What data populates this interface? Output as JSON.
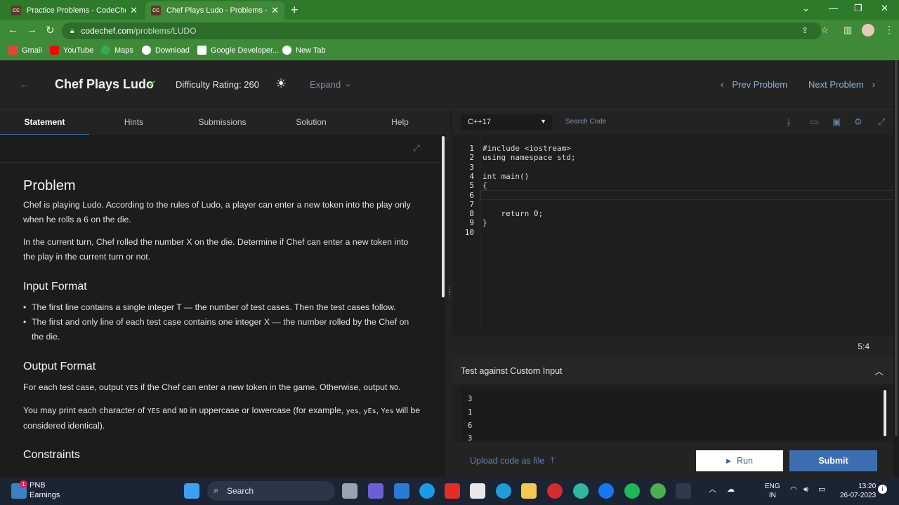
{
  "browser": {
    "tabs": [
      {
        "title": "Practice Problems - CodeChef",
        "active": false
      },
      {
        "title": "Chef Plays Ludo - Problems - Co",
        "active": true
      }
    ],
    "new_tab_glyph": "+",
    "favicon_text": "CC",
    "url_host": "codechef.com",
    "url_path": "/problems/LUDO",
    "bookmarks": [
      {
        "label": "Gmail",
        "color": "#ea4335"
      },
      {
        "label": "YouTube",
        "color": "#ff0000"
      },
      {
        "label": "Maps",
        "color": "#34a853"
      },
      {
        "label": "Download",
        "color": "#ffffff"
      },
      {
        "label": "Google Developer...",
        "color": "#ffffff"
      },
      {
        "label": "New Tab",
        "color": "#ffffff"
      }
    ]
  },
  "header": {
    "title": "Chef Plays Ludo",
    "difficulty": "Difficulty Rating: 260",
    "expand": "Expand",
    "prev": "Prev Problem",
    "next": "Next Problem"
  },
  "left_tabs": [
    "Statement",
    "Hints",
    "Submissions",
    "Solution",
    "Help"
  ],
  "statement": {
    "heading": "Problem",
    "p1": "Chef is playing Ludo. According to the rules of Ludo, a player can enter a new token into the play only when he rolls a 6 on the die.",
    "p2": "In the current turn, Chef rolled the number X on the die. Determine if Chef can enter a new token into the play in the current turn or not.",
    "input_heading": "Input Format",
    "input_items": [
      "The first line contains a single integer T — the number of test cases. Then the test cases follow.",
      "The first and only line of each test case contains one integer X — the number rolled by the Chef on the die."
    ],
    "output_heading": "Output Format",
    "output_p1_a": "For each test case, output ",
    "output_p1_yes": "YES",
    "output_p1_b": " if the Chef can enter a new token in the game. Otherwise, output ",
    "output_p1_no": "NO",
    "output_p1_c": ".",
    "output_p2_a": "You may print each character of ",
    "output_p2_yes": "YES",
    "output_p2_b": " and ",
    "output_p2_no": "NO",
    "output_p2_c": " in uppercase or lowercase (for example, ",
    "output_p2_e1": "yes",
    "output_p2_sep1": ", ",
    "output_p2_e2": "yEs",
    "output_p2_sep2": ", ",
    "output_p2_e3": "Yes",
    "output_p2_d": " will be considered identical).",
    "constraints_heading": "Constraints"
  },
  "editor": {
    "language": "C++17",
    "search_placeholder": "Search Code",
    "line_numbers": [
      "1",
      "2",
      "3",
      "4",
      "5",
      "6",
      "7",
      "8",
      "9",
      "10"
    ],
    "lines": [
      "#include <iostream>",
      "using namespace std;",
      "",
      "int main()",
      "{",
      "",
      "",
      "    return 0;",
      "}",
      ""
    ],
    "cursor": "5:4"
  },
  "custom_input": {
    "label": "Test against Custom Input",
    "values": [
      "3",
      "1",
      "6",
      "3"
    ]
  },
  "actions": {
    "upload": "Upload code as file",
    "run": "Run",
    "submit": "Submit"
  },
  "taskbar": {
    "news_title": "PNB",
    "news_sub": "Earnings",
    "news_badge": "1",
    "search": "Search",
    "lang_top": "ENG",
    "lang_bottom": "IN",
    "time": "13:20",
    "date": "26-07-2023"
  }
}
